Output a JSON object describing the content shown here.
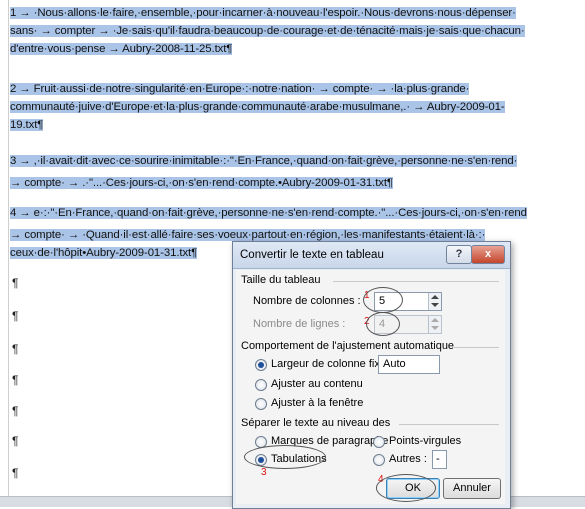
{
  "document": {
    "paragraphs": [
      {
        "lines": [
          "1 → ·Nous·allons·le·faire,·ensemble,·pour·incarner·à·nouveau·l'espoir.·Nous·devrons·nous·dépenser·",
          "sans· → compter → ·Je·sais·qu'il·faudra·beaucoup·de·courage·et·de·ténacité·mais·je·sais·que·chacun·",
          "d'entre·vous·pense → Aubry-2008-11-25.txt¶"
        ]
      },
      {
        "lines": [
          "2 → Fruit·aussi·de·notre·singularité·en·Europe·:·notre·nation· → compte· → ·la·plus·grande·",
          "communauté·juive·d'Europe·et·la·plus·grande·communauté·arabe·musulmane,.· → Aubry-2009-01-",
          "19.txt¶"
        ]
      },
      {
        "lines": [
          "3 → ,·il·avait·dit·avec·ce·sourire·inimitable·:·\"·En·France,·quand·on·fait·grève,·personne·ne·s'en·rend·",
          "→ compte· → .·\"...·Ces·jours-ci,·on·s'en·rend·compte.•Aubry-2009-01-31.txt¶"
        ]
      },
      {
        "lines": [
          "4 → e·:·\"·En·France,·quand·on·fait·grève,·personne·ne·s'en·rend·compte.·\"...·Ces·jours-ci,·on·s'en·rend",
          "→ compte· → ·Quand·il·est·allé·faire·ses·voeux·partout·en·région,·les·manifestants·étaient·là·:·",
          "ceux·de·l'hôpit•Aubry-2009-01-31.txt¶"
        ]
      }
    ],
    "pilcrow": "¶"
  },
  "dialog": {
    "title": "Convertir le texte en tableau",
    "help_label": "?",
    "close_label": "x",
    "section_size": "Taille du tableau",
    "columns_label": "Nombre de colonnes :",
    "columns_value": "5",
    "rows_label": "Nombre de lignes :",
    "rows_value": "4",
    "section_autofit": "Comportement de l'ajustement automatique",
    "fixed_width_label": "Largeur de colonne fixe :",
    "fixed_width_value": "Auto",
    "fit_content_label": "Ajuster au contenu",
    "fit_window_label": "Ajuster à la fenêtre",
    "section_separator": "Séparer le texte au niveau des",
    "sep_paragraph_label": "Marques de paragraphe",
    "sep_semicolon_label": "Points-virgules",
    "sep_tab_label": "Tabulations",
    "sep_other_label": "Autres :",
    "sep_other_value": "-",
    "ok_label": "OK",
    "cancel_label": "Annuler"
  },
  "annotations": [
    "1",
    "2",
    "3",
    "4"
  ],
  "colors": {
    "selection": "#aac4e8",
    "annotation": "#dd1111"
  }
}
